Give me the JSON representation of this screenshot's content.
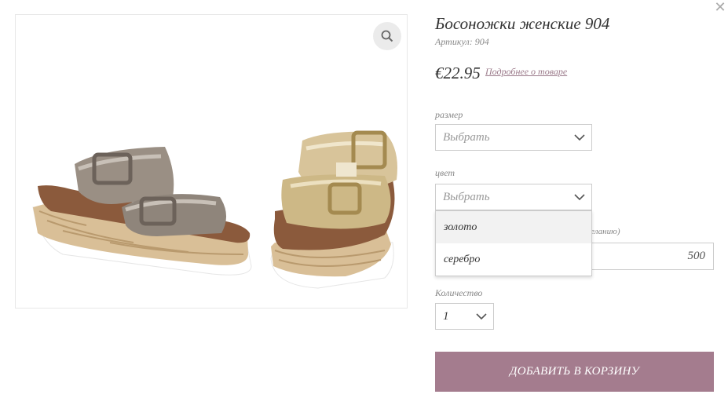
{
  "close_icon": "close-icon",
  "product": {
    "title": "Босоножки женские 904",
    "sku_label": "Артикул:",
    "sku_value": "904",
    "price": "€22.95",
    "details_link": "Подробнее о товаре",
    "zoom_icon": "zoom-icon",
    "image_alt": "sandals-image"
  },
  "size": {
    "label": "размер",
    "value": "Выбрать"
  },
  "color": {
    "label": "цвет",
    "value": "Выбрать",
    "options": [
      "золото",
      "серебро"
    ]
  },
  "amount": {
    "label_partial": "желанию)",
    "value": "500"
  },
  "quantity": {
    "label": "Количество",
    "value": "1"
  },
  "add_to_cart": "ДОБАВИТЬ В КОРЗИНУ",
  "colors": {
    "accent": "#a47c8e",
    "link": "#9b7a8a"
  }
}
